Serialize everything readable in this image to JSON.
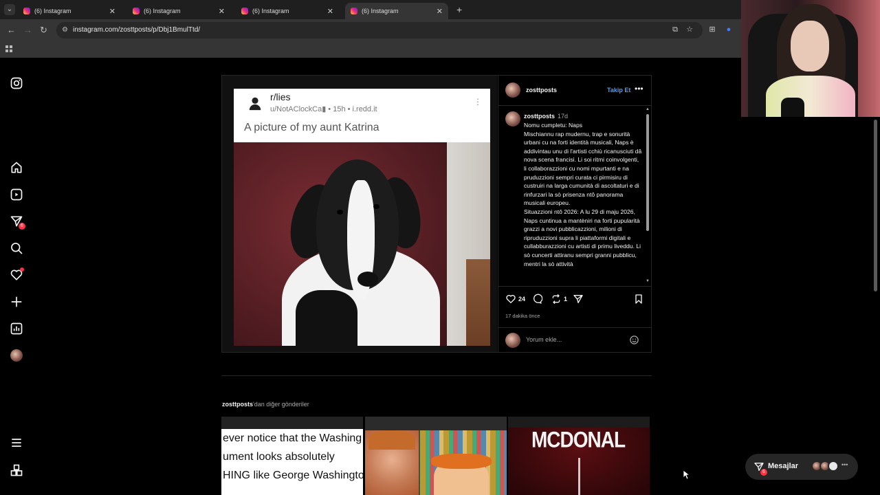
{
  "browser": {
    "tabs": [
      {
        "title": "(6) Instagram",
        "active": false
      },
      {
        "title": "(6) Instagram",
        "active": false
      },
      {
        "title": "(6) Instagram",
        "active": false
      },
      {
        "title": "(6) Instagram",
        "active": true
      }
    ],
    "url": "instagram.com/zosttposts/p/Dbj1BmulTtd/"
  },
  "sidenav": {
    "items": [
      {
        "icon": "instagram-logo-icon"
      },
      {
        "icon": "home-icon"
      },
      {
        "icon": "reels-icon"
      },
      {
        "icon": "messages-icon",
        "badge": "6"
      },
      {
        "icon": "search-icon"
      },
      {
        "icon": "notifications-icon"
      },
      {
        "icon": "create-icon"
      },
      {
        "icon": "dashboard-icon"
      },
      {
        "icon": "profile-avatar"
      },
      {
        "icon": "more-menu-icon"
      },
      {
        "icon": "also-from-meta-icon"
      }
    ]
  },
  "post": {
    "reddit": {
      "subreddit": "r/lies",
      "meta": "u/NotAClockCa▮ • 15h • i.redd.it",
      "title": "A picture of my aunt Katrina"
    },
    "author": "zosttposts",
    "follow_label": "Takip Et",
    "caption_user": "zosttposts",
    "caption_age": "17d",
    "caption": "Nomu cumpletu: Naps\nMischiannu rap mudernu, trap e sonurità urbani cu na forti identità musicali, Naps è addivintau unu di l'artisti cchiù ricanusciuti dâ nova scena francisi. Li soi ritmi coinvolgenti, li collaborazzioni cu nomi mpurtanti e na pruduzzioni sempri curata ci pirmisiru di custruiri na larga cumunità di ascoltaturi e di rinfurzari la sò prisenza ntô panorama musicali europeu.\nSituazzioni ntô 2026: A lu 29 di maju 2026, Naps cuntinua a mantèniri na forti pupularità grazzi a novi pubblicazzioni, milioni di ripruduzzioni supra li piattaformi digitali e cullabburazzioni cu artisti di primu liveddu. Li sò cuncerti attiranu sempri granni pubblicu, mentri la sò attività",
    "likes": "24",
    "reposts": "1",
    "time_ago": "17 dakika önce",
    "comment_placeholder": "Yorum ekle..."
  },
  "more_posts": {
    "user": "zosttposts",
    "suffix": "'dan diğer gönderiler",
    "tile1_text": "ever notice that the Washing\nument looks absolutely\nHING like George Washingto",
    "tile3_text": "MCDONAL"
  },
  "messages": {
    "label": "Mesajlar",
    "badge": "6"
  },
  "colors": {
    "accent_blue": "#4a9eff",
    "badge_red": "#ff3040",
    "background": "#000000"
  }
}
